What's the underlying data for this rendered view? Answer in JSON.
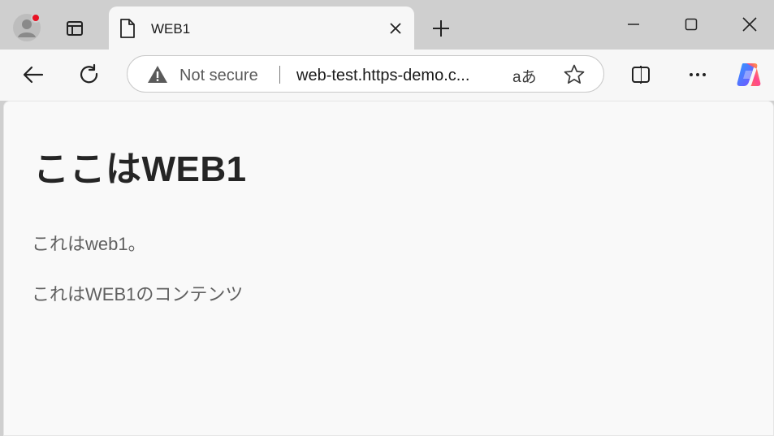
{
  "browser": {
    "tab": {
      "title": "WEB1"
    },
    "address": {
      "security_label": "Not secure",
      "url": "web-test.https-demo.c...",
      "read_aloud_label": "aあ"
    },
    "colors": {
      "profile_badge": "#e81123",
      "warning": "#5a5a5a"
    }
  },
  "page": {
    "heading": "ここはWEB1",
    "paragraphs": [
      "これはweb1。",
      "これはWEB1のコンテンツ"
    ]
  }
}
